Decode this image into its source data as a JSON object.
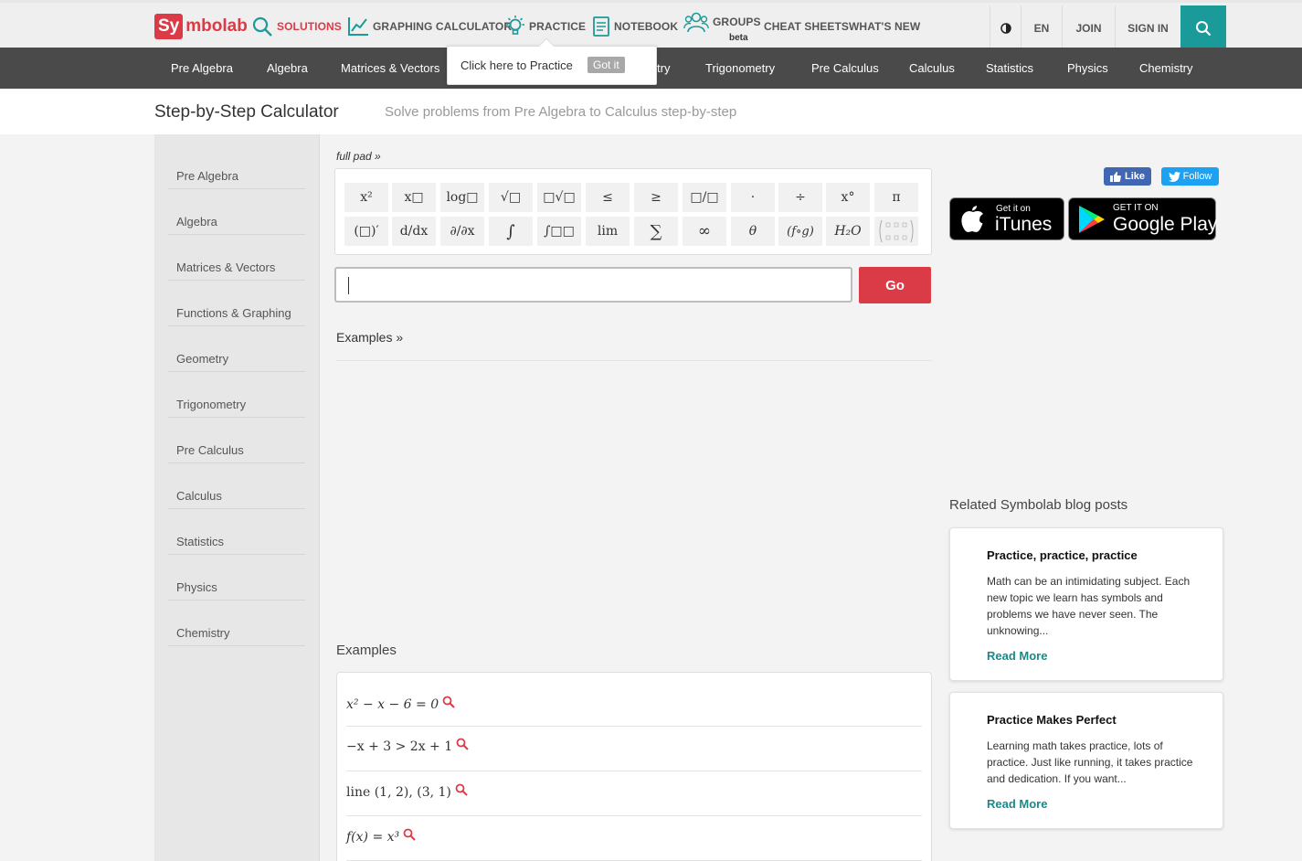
{
  "header": {
    "logo_sy": "Sy",
    "logo_rest": "mbolab",
    "nav": [
      {
        "label": "SOLUTIONS",
        "icon": "search-icon"
      },
      {
        "label": "GRAPHING CALCULATOR",
        "icon": "graph-icon"
      },
      {
        "label": "PRACTICE",
        "icon": "lightbulb-icon"
      },
      {
        "label": "NOTEBOOK",
        "icon": "notebook-icon"
      },
      {
        "label": "GROUPS",
        "icon": "groups-icon",
        "badge": "beta"
      },
      {
        "label": "CHEAT SHEETS"
      },
      {
        "label": "WHAT'S NEW"
      }
    ],
    "language": "EN",
    "join": "JOIN",
    "sign_in": "SIGN IN",
    "accent": "#db3b47",
    "teal": "#1b9a9a"
  },
  "subjects": [
    "Pre Algebra",
    "Algebra",
    "Matrices & Vectors",
    "try",
    "Trigonometry",
    "Pre Calculus",
    "Calculus",
    "Statistics",
    "Physics",
    "Chemistry"
  ],
  "popover": {
    "text": "Click here to Practice",
    "button": "Got it"
  },
  "title_bar": {
    "title": "Step-by-Step Calculator",
    "subtitle": "Solve problems from Pre Algebra to Calculus step-by-step"
  },
  "sidebar": [
    "Pre Algebra",
    "Algebra",
    "Matrices & Vectors",
    "Functions & Graphing",
    "Geometry",
    "Trigonometry",
    "Pre Calculus",
    "Calculus",
    "Statistics",
    "Physics",
    "Chemistry"
  ],
  "keypad": {
    "full_pad": "full pad »",
    "row1": [
      "x²",
      "x□",
      "log□",
      "√□",
      "□√□",
      "≤",
      "≥",
      "□/□",
      "·",
      "÷",
      "x°",
      "π"
    ],
    "row2": [
      "(□)′",
      "d/dx",
      "∂/∂x",
      "∫",
      "∫□□",
      "lim",
      "∑",
      "∞",
      "θ",
      "(f∘g)",
      "H₂O",
      "matrix"
    ]
  },
  "input": {
    "value": "",
    "go": "Go"
  },
  "examples_link": "Examples »",
  "examples_title": "Examples",
  "examples": [
    "x² − x − 6 = 0",
    "−x + 3 > 2x + 1",
    "line (1, 2), (3, 1)",
    "f(x) = x³"
  ],
  "social": {
    "like": "Like",
    "follow": "Follow"
  },
  "stores": {
    "itunes_small": "Get it on",
    "itunes_big": "iTunes",
    "play_small": "GET IT ON",
    "play_big": "Google Play"
  },
  "blog": {
    "heading": "Related Symbolab blog posts",
    "posts": [
      {
        "title": "Practice, practice, practice",
        "body": "Math can be an intimidating subject. Each new topic we learn has symbols and problems we have never seen. The unknowing...",
        "more": "Read More"
      },
      {
        "title": "Practice Makes Perfect",
        "body": "Learning math takes practice, lots of practice. Just like running, it takes practice and dedication. If you want...",
        "more": "Read More"
      }
    ]
  }
}
